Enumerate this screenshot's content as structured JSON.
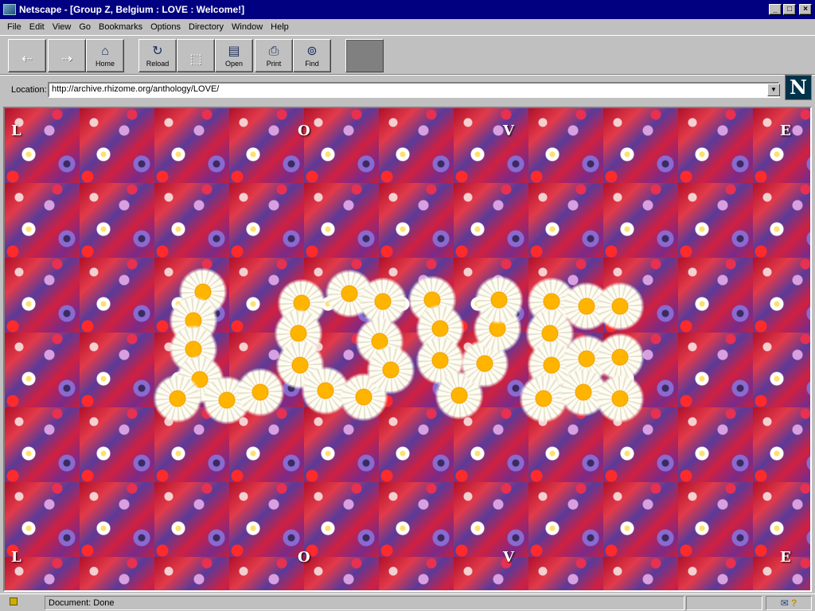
{
  "window": {
    "title": "Netscape - [Group Z, Belgium : LOVE : Welcome!]",
    "minimize_symbol": "_",
    "maximize_symbol": "□",
    "close_symbol": "×"
  },
  "menu": {
    "items": [
      "File",
      "Edit",
      "View",
      "Go",
      "Bookmarks",
      "Options",
      "Directory",
      "Window",
      "Help"
    ]
  },
  "toolbar": {
    "buttons": [
      {
        "label": "",
        "icon": "back-arrow-icon"
      },
      {
        "label": "",
        "icon": "forward-arrow-icon"
      },
      {
        "label": "Home",
        "icon": "home-icon"
      },
      {
        "label": "Reload",
        "icon": "reload-icon"
      },
      {
        "label": "",
        "icon": "images-icon"
      },
      {
        "label": "Open",
        "icon": "open-icon"
      },
      {
        "label": "Print",
        "icon": "print-icon"
      },
      {
        "label": "Find",
        "icon": "find-binoculars-icon"
      },
      {
        "label": "",
        "icon": "stop-icon"
      }
    ]
  },
  "location": {
    "label": "Location:",
    "url": "http://archive.rhizome.org/anthology/LOVE/"
  },
  "throbber": {
    "letter": "N"
  },
  "content": {
    "corner_letters": [
      "L",
      "O",
      "V",
      "E",
      "L",
      "O",
      "V",
      "E"
    ],
    "colors": {
      "flower_red": "#d02040",
      "flower_purple": "#5a3a9a",
      "daisy_center": "#ffb400"
    }
  },
  "status": {
    "text": "Document: Done",
    "mail_icon": "mail-icon",
    "help_icon": "?"
  }
}
